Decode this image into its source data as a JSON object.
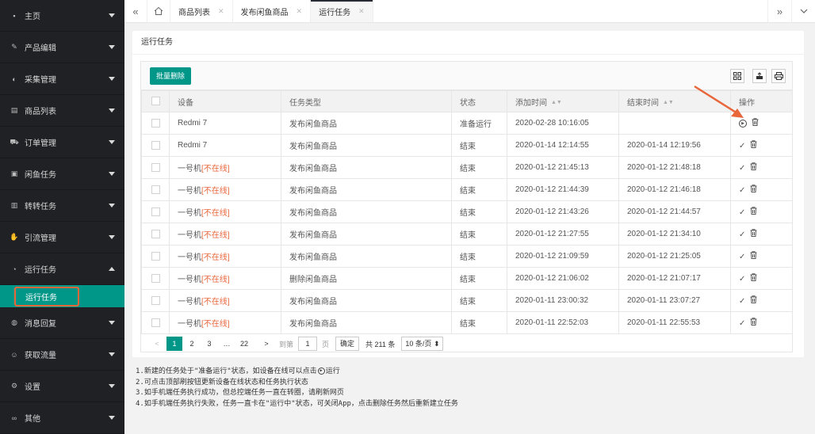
{
  "sidebar": {
    "items": [
      {
        "label": "主页",
        "icon": "home-icon"
      },
      {
        "label": "产品编辑",
        "icon": "edit-icon"
      },
      {
        "label": "采集管理",
        "icon": "collect-icon"
      },
      {
        "label": "商品列表",
        "icon": "list-icon"
      },
      {
        "label": "订单管理",
        "icon": "cart-icon"
      },
      {
        "label": "闲鱼任务",
        "icon": "task-icon"
      },
      {
        "label": "转转任务",
        "icon": "transfer-icon"
      },
      {
        "label": "引流管理",
        "icon": "traffic-icon"
      },
      {
        "label": "运行任务",
        "icon": "gauge-icon"
      },
      {
        "label": "消息回复",
        "icon": "message-icon"
      },
      {
        "label": "获取流量",
        "icon": "user-icon"
      },
      {
        "label": "设置",
        "icon": "gear-icon"
      },
      {
        "label": "其他",
        "icon": "link-icon"
      }
    ],
    "sub_active": "运行任务"
  },
  "tabs": [
    {
      "label": "商品列表"
    },
    {
      "label": "发布闲鱼商品"
    },
    {
      "label": "运行任务"
    }
  ],
  "card": {
    "title": "运行任务"
  },
  "toolbar": {
    "batch_delete": "批量删除"
  },
  "table": {
    "headers": [
      "设备",
      "任务类型",
      "状态",
      "添加时间",
      "结束时间",
      "操作"
    ],
    "offline_tag": "[不在线]",
    "rows": [
      {
        "device": "Redmi 7",
        "offline": false,
        "type": "发布闲鱼商品",
        "status": "准备运行",
        "added": "2020-02-28 10:16:05",
        "ended": "",
        "action": "run"
      },
      {
        "device": "Redmi 7",
        "offline": false,
        "type": "发布闲鱼商品",
        "status": "结束",
        "added": "2020-01-14 12:14:55",
        "ended": "2020-01-14 12:19:56",
        "action": "done"
      },
      {
        "device": "一号机",
        "offline": true,
        "type": "发布闲鱼商品",
        "status": "结束",
        "added": "2020-01-12 21:45:13",
        "ended": "2020-01-12 21:48:18",
        "action": "done"
      },
      {
        "device": "一号机",
        "offline": true,
        "type": "发布闲鱼商品",
        "status": "结束",
        "added": "2020-01-12 21:44:39",
        "ended": "2020-01-12 21:46:18",
        "action": "done"
      },
      {
        "device": "一号机",
        "offline": true,
        "type": "发布闲鱼商品",
        "status": "结束",
        "added": "2020-01-12 21:43:26",
        "ended": "2020-01-12 21:44:57",
        "action": "done"
      },
      {
        "device": "一号机",
        "offline": true,
        "type": "发布闲鱼商品",
        "status": "结束",
        "added": "2020-01-12 21:27:55",
        "ended": "2020-01-12 21:34:10",
        "action": "done"
      },
      {
        "device": "一号机",
        "offline": true,
        "type": "发布闲鱼商品",
        "status": "结束",
        "added": "2020-01-12 21:09:59",
        "ended": "2020-01-12 21:25:05",
        "action": "done"
      },
      {
        "device": "一号机",
        "offline": true,
        "type": "删除闲鱼商品",
        "status": "结束",
        "added": "2020-01-12 21:06:02",
        "ended": "2020-01-12 21:07:17",
        "action": "done"
      },
      {
        "device": "一号机",
        "offline": true,
        "type": "发布闲鱼商品",
        "status": "结束",
        "added": "2020-01-11 23:00:32",
        "ended": "2020-01-11 23:07:27",
        "action": "done"
      },
      {
        "device": "一号机",
        "offline": true,
        "type": "发布闲鱼商品",
        "status": "结束",
        "added": "2020-01-11 22:52:03",
        "ended": "2020-01-11 22:55:53",
        "action": "done"
      }
    ]
  },
  "pager": {
    "prev": "<",
    "pages": [
      "1",
      "2",
      "3",
      "…",
      "22"
    ],
    "next": ">",
    "goto_label": "到第",
    "goto_value": "1",
    "page_unit": "页",
    "confirm": "确定",
    "total": "共 211 条",
    "per_page": "10 条/页"
  },
  "notes": [
    "1.新建的任务处于\"准备运行\"状态，如设备在线可以点击",
    "运行",
    "2.可点击顶部刷按钮更新设备在线状态和任务执行状态",
    "3.如手机端任务执行成功，但总控端任务一直在转圈，请刷新网页",
    "4.如手机端任务执行失败，任务一直卡在\"运行中\"状态，可关闭App，点击删除任务然后重新建立任务"
  ],
  "colors": {
    "accent": "#009688",
    "sidebar_bg": "#1f2125",
    "offline": "#e8663a",
    "arrow": "#e8663a"
  }
}
